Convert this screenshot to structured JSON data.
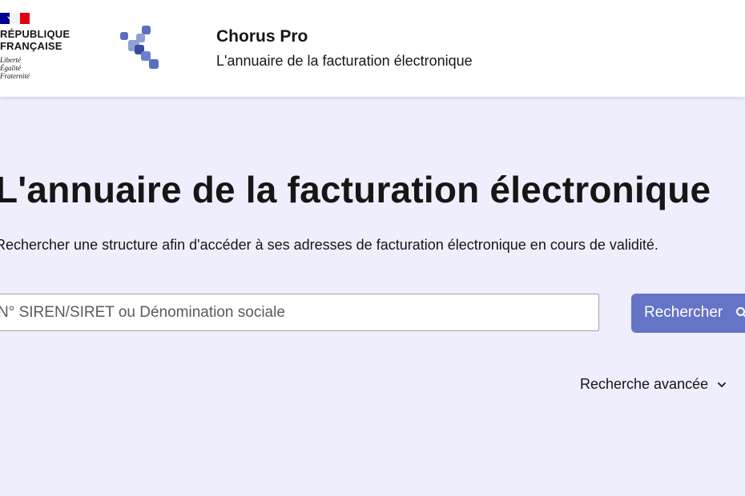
{
  "header": {
    "republique_line1": "RÉPUBLIQUE",
    "republique_line2": "FRANÇAISE",
    "devise_1": "Liberté",
    "devise_2": "Égalité",
    "devise_3": "Fraternité",
    "app_title": "Chorus Pro",
    "app_subtitle": "L'annuaire de la facturation électronique"
  },
  "main": {
    "title": "L'annuaire de la facturation électronique",
    "description": "Rechercher une structure afin d'accéder à ses adresses de facturation électronique en cours de validité.",
    "search": {
      "placeholder": "N° SIREN/SIRET ou Dénomination sociale",
      "button_label": "Rechercher",
      "button_icon": "search-icon"
    },
    "advanced_search": {
      "label": "Recherche avancée",
      "icon": "chevron-down-icon"
    }
  },
  "colors": {
    "page_background": "#efeefd",
    "header_background": "#ffffff",
    "button_background": "#6574c7",
    "flag_blue": "#000091",
    "flag_red": "#e1000f",
    "logo_blue": "#5b6ec2"
  }
}
